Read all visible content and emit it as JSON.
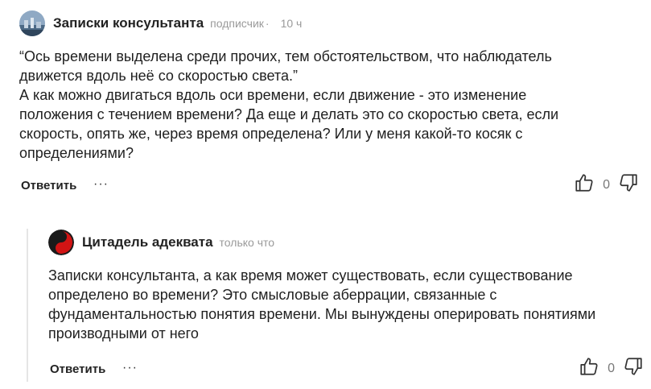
{
  "comments": [
    {
      "author": "Записки консультанта",
      "badge": "подписчик",
      "separator": "·",
      "time": "10 ч",
      "text": "“Ось времени выделена среди прочих, тем обстоятельством, что наблюдатель\nдвижется вдоль неё со скоростью света.”\nА как можно двигаться вдоль оси времени, если движение - это изменение\nположения с течением времени? Да еще и делать это со скоростью света, если\nскорость, опять же, через время определена? Или у меня какой-то косяк с\nопределениями?",
      "reply_label": "Ответить",
      "more_label": "···",
      "likes": "0",
      "avatar_icon": "landscape-photo-avatar"
    },
    {
      "author": "Цитадель адеквата",
      "time": "только что",
      "text": "Записки консультанта, а как время может существовать, если существование\nопределено во времени? Это смысловые аберрации, связанные с\nфундаментальностью понятия времени. Мы вынуждены оперировать понятиями\nпроизводными от него",
      "reply_label": "Ответить",
      "more_label": "···",
      "likes": "0",
      "avatar_icon": "red-yin-yang-avatar"
    }
  ],
  "colors": {
    "text": "#1f1f1f",
    "meta": "#9a9a9a",
    "thread_line": "#e5e5e5"
  }
}
